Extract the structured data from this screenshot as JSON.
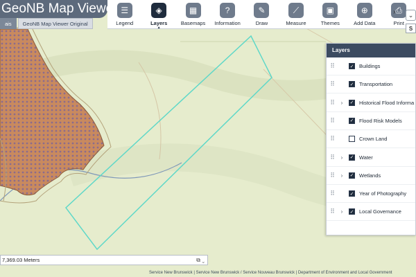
{
  "app": {
    "title": "GeoNB Map Viewer",
    "tabs": [
      "ais",
      "GeoNB Map Viewer Original"
    ]
  },
  "toolbar": {
    "tools": [
      {
        "label": "Legend",
        "icon": "legend-icon",
        "glyph": "☰"
      },
      {
        "label": "Layers",
        "icon": "layers-icon",
        "glyph": "◈",
        "active": true
      },
      {
        "label": "Basemaps",
        "icon": "basemaps-icon",
        "glyph": "▦"
      },
      {
        "label": "Information",
        "icon": "information-icon",
        "glyph": "?"
      },
      {
        "label": "Draw",
        "icon": "draw-icon",
        "glyph": "✎"
      },
      {
        "label": "Measure",
        "icon": "measure-icon",
        "glyph": "⟋"
      },
      {
        "label": "Themes",
        "icon": "themes-icon",
        "glyph": "▣"
      },
      {
        "label": "Add Data",
        "icon": "add-data-icon",
        "glyph": "⊕"
      },
      {
        "label": "Print",
        "icon": "print-icon",
        "glyph": "⎙"
      }
    ],
    "more_glyph": "›",
    "dropdown_glyph": "⌄",
    "dropdown2_text": "S"
  },
  "layers_panel": {
    "title": "Layers",
    "layers": [
      {
        "name": "Buildings",
        "checked": true,
        "expandable": false
      },
      {
        "name": "Transportation",
        "checked": true,
        "expandable": false
      },
      {
        "name": "Historical Flood Informa",
        "checked": true,
        "expandable": true
      },
      {
        "name": "Flood Risk Models",
        "checked": true,
        "expandable": false
      },
      {
        "name": "Crown Land",
        "checked": false,
        "expandable": false
      },
      {
        "name": "Water",
        "checked": true,
        "expandable": true
      },
      {
        "name": "Wetlands",
        "checked": true,
        "expandable": true
      },
      {
        "name": "Year of Photography",
        "checked": true,
        "expandable": false
      },
      {
        "name": "Local Governance",
        "checked": true,
        "expandable": true
      }
    ]
  },
  "scale": {
    "text": "7,369.03 Meters"
  },
  "attribution": "Service New Brunswick | Service New Brunswick / Service Nouveau Brunswick | Department of Environment and Local Government",
  "colors": {
    "map_background": "#e6eccd",
    "wetland_fill": "#c98a5e",
    "selection_outline": "#5fd8c8"
  }
}
